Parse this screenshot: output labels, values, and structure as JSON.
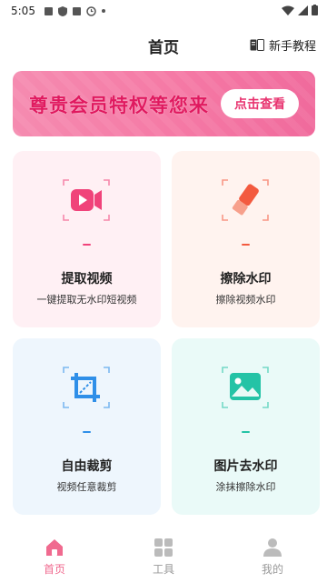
{
  "status_bar": {
    "time": "5:05"
  },
  "header": {
    "title": "首页",
    "tutorial_label": "新手教程"
  },
  "banner": {
    "text": "尊贵会员特权等您来",
    "button_label": "点击查看"
  },
  "features": [
    {
      "title": "提取视频",
      "subtitle": "一键提取无水印短视频",
      "icon": "video-camera-icon",
      "accent": "#f0437a"
    },
    {
      "title": "擦除水印",
      "subtitle": "擦除视频水印",
      "icon": "eraser-icon",
      "accent": "#f35a3f"
    },
    {
      "title": "自由裁剪",
      "subtitle": "视频任意裁剪",
      "icon": "crop-icon",
      "accent": "#2f8fe8"
    },
    {
      "title": "图片去水印",
      "subtitle": "涂抹擦除水印",
      "icon": "image-icon",
      "accent": "#24c3a6"
    }
  ],
  "bottom_nav": [
    {
      "label": "首页",
      "icon": "home-icon",
      "active": true
    },
    {
      "label": "工具",
      "icon": "grid-icon",
      "active": false
    },
    {
      "label": "我的",
      "icon": "user-icon",
      "active": false
    }
  ],
  "colors": {
    "active": "#f06a8f",
    "inactive": "#999999",
    "banner": "#f579a5"
  }
}
